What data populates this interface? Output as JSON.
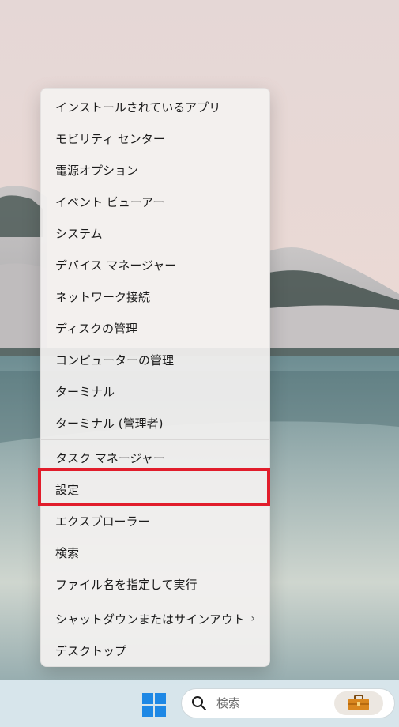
{
  "context_menu": {
    "items": [
      {
        "label": "インストールされているアプリ"
      },
      {
        "label": "モビリティ センター"
      },
      {
        "label": "電源オプション"
      },
      {
        "label": "イベント ビューアー"
      },
      {
        "label": "システム"
      },
      {
        "label": "デバイス マネージャー"
      },
      {
        "label": "ネットワーク接続"
      },
      {
        "label": "ディスクの管理"
      },
      {
        "label": "コンピューターの管理"
      },
      {
        "label": "ターミナル"
      },
      {
        "label": "ターミナル (管理者)"
      },
      {
        "label": "タスク マネージャー"
      },
      {
        "label": "設定"
      },
      {
        "label": "エクスプローラー"
      },
      {
        "label": "検索"
      },
      {
        "label": "ファイル名を指定して実行"
      },
      {
        "label": "シャットダウンまたはサインアウト",
        "submenu_indicator": "›"
      },
      {
        "label": "デスクトップ"
      }
    ],
    "highlighted_item": "設定",
    "highlight_color": "#e11d2b"
  },
  "taskbar": {
    "search_placeholder": "検索",
    "start_icon": "windows-logo-icon",
    "search_icon": "search-icon",
    "badge_icon": "briefcase-icon"
  }
}
